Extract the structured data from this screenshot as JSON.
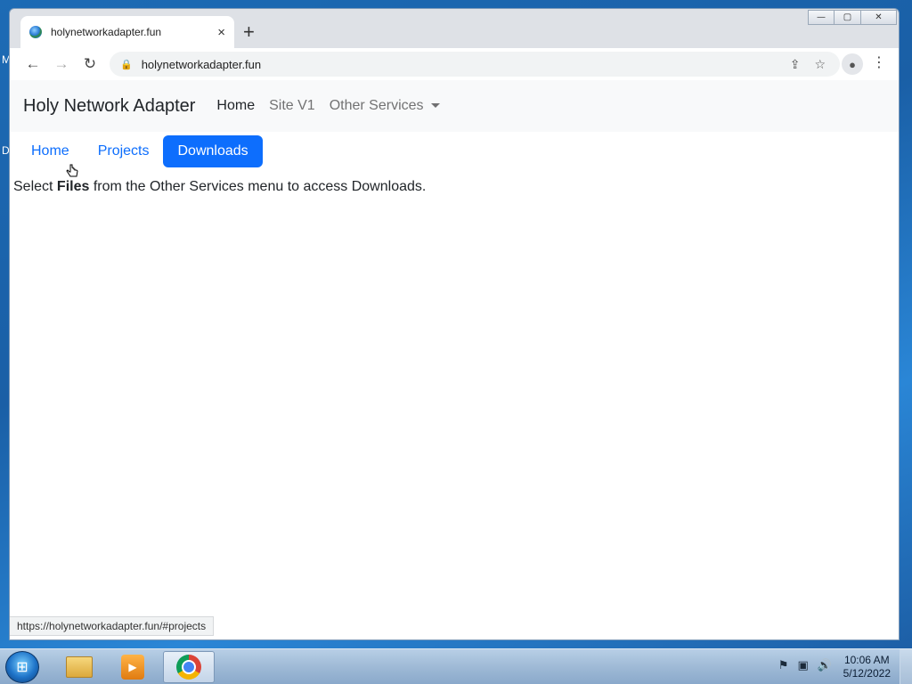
{
  "desktop": {
    "edge_letters": [
      "M",
      "D"
    ]
  },
  "window": {
    "controls": {
      "minimize": "—",
      "maximize": "▢",
      "close": "✕"
    }
  },
  "tab": {
    "title": "holynetworkadapter.fun",
    "close_icon": "×",
    "new_tab_icon": "+"
  },
  "toolbar": {
    "back_icon": "←",
    "forward_icon": "→",
    "reload_icon": "↻",
    "url": "holynetworkadapter.fun",
    "lock_icon": "🔒",
    "share_icon": "⇪",
    "bookmark_icon": "☆",
    "profile_icon": "●",
    "menu_icon": "⋮"
  },
  "navbar": {
    "brand": "Holy Network Adapter",
    "links": [
      "Home",
      "Site V1",
      "Other Services"
    ]
  },
  "pills": [
    "Home",
    "Projects",
    "Downloads"
  ],
  "content": {
    "prefix": "Select ",
    "bold": "Files",
    "suffix": " from the Other Services menu to access Downloads."
  },
  "status_url": "https://holynetworkadapter.fun/#projects",
  "taskbar": {
    "start_icon": "⊞",
    "media_icon": "▶",
    "tray_icons": [
      "⚑",
      "▣",
      "🔊"
    ],
    "clock_time": "10:06 AM",
    "clock_date": "5/12/2022"
  }
}
